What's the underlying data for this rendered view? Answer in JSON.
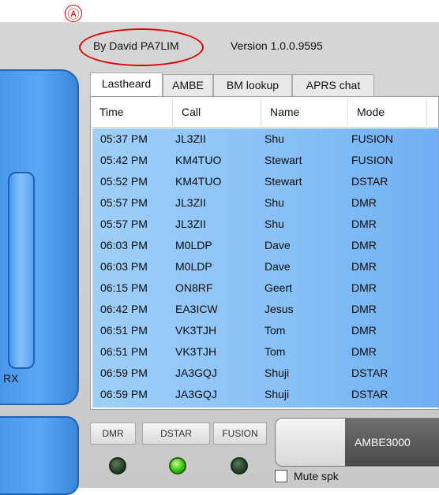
{
  "annotation": {
    "marker": "Ⓐ"
  },
  "info": {
    "author": "By David PA7LIM",
    "version": "Version 1.0.0.9595"
  },
  "tabs": [
    {
      "label": "Lastheard",
      "active": true
    },
    {
      "label": "AMBE",
      "active": false
    },
    {
      "label": "BM lookup",
      "active": false
    },
    {
      "label": "APRS chat",
      "active": false
    }
  ],
  "columns": [
    "Time",
    "Call",
    "Name",
    "Mode"
  ],
  "rows": [
    {
      "time": "05:37 PM",
      "call": "JL3ZII",
      "name": "Shu",
      "mode": "FUSION"
    },
    {
      "time": "05:42 PM",
      "call": "KM4TUO",
      "name": "Stewart",
      "mode": "FUSION"
    },
    {
      "time": "05:52 PM",
      "call": "KM4TUO",
      "name": "Stewart",
      "mode": "DSTAR"
    },
    {
      "time": "05:57 PM",
      "call": "JL3ZII",
      "name": "Shu",
      "mode": "DMR"
    },
    {
      "time": "05:57 PM",
      "call": "JL3ZII",
      "name": "Shu",
      "mode": "DMR"
    },
    {
      "time": "06:03 PM",
      "call": "M0LDP",
      "name": "Dave",
      "mode": "DMR"
    },
    {
      "time": "06:03 PM",
      "call": "M0LDP",
      "name": "Dave",
      "mode": "DMR"
    },
    {
      "time": "06:15 PM",
      "call": "ON8RF",
      "name": "Geert",
      "mode": "DMR"
    },
    {
      "time": "06:42 PM",
      "call": "EA3ICW",
      "name": "Jesus",
      "mode": "DMR"
    },
    {
      "time": "06:51 PM",
      "call": "VK3TJH",
      "name": "Tom",
      "mode": "DMR"
    },
    {
      "time": "06:51 PM",
      "call": "VK3TJH",
      "name": "Tom",
      "mode": "DMR"
    },
    {
      "time": "06:59 PM",
      "call": "JA3GQJ",
      "name": "Shuji",
      "mode": "DSTAR"
    },
    {
      "time": "06:59 PM",
      "call": "JA3GQJ",
      "name": "Shuji",
      "mode": "DSTAR"
    }
  ],
  "left": {
    "rx_label": "RX"
  },
  "modes": [
    {
      "label": "DMR",
      "led": "off"
    },
    {
      "label": "DSTAR",
      "led": "on"
    },
    {
      "label": "FUSION",
      "led": "off"
    }
  ],
  "ambe": {
    "label": "AMBE3000"
  },
  "mute": {
    "label": "Mute spk",
    "checked": false
  }
}
